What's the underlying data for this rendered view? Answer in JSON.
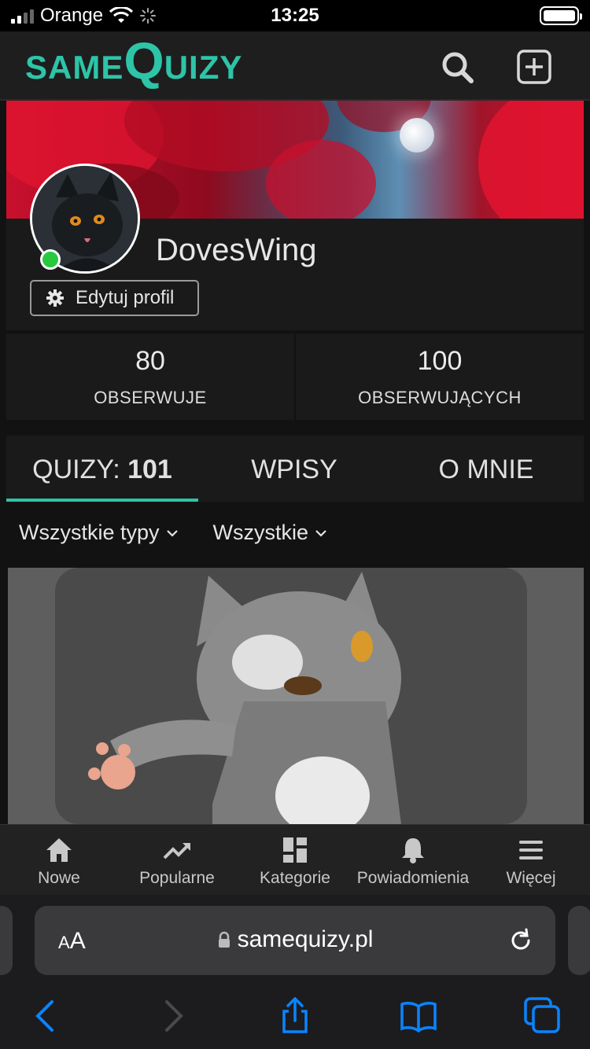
{
  "status_bar": {
    "carrier": "Orange",
    "time": "13:25"
  },
  "header": {
    "logo_same": "SAME",
    "logo_q": "Q",
    "logo_uizy": "UIZY"
  },
  "profile": {
    "username": "DovesWing",
    "edit_label": "Edytuj profil",
    "online": true
  },
  "stats": [
    {
      "value": "80",
      "label": "OBSERWUJE"
    },
    {
      "value": "100",
      "label": "OBSERWUJĄCYCH"
    }
  ],
  "tabs": [
    {
      "label": "QUIZY: ",
      "count": "101",
      "active": true
    },
    {
      "label": "WPISY",
      "active": false
    },
    {
      "label": "O MNIE",
      "active": false
    }
  ],
  "filters": [
    {
      "label": "Wszystkie typy"
    },
    {
      "label": "Wszystkie"
    }
  ],
  "bottom_nav": [
    {
      "label": "Nowe",
      "icon": "home-icon"
    },
    {
      "label": "Popularne",
      "icon": "trending-icon"
    },
    {
      "label": "Kategorie",
      "icon": "grid-icon"
    },
    {
      "label": "Powiadomienia",
      "icon": "bell-icon"
    },
    {
      "label": "Więcej",
      "icon": "menu-icon"
    }
  ],
  "browser": {
    "aa_small": "A",
    "aa_big": "A",
    "url": "samequizy.pl"
  },
  "colors": {
    "accent": "#2ec4a8",
    "online": "#27c93f",
    "ios_blue": "#0a84ff"
  }
}
